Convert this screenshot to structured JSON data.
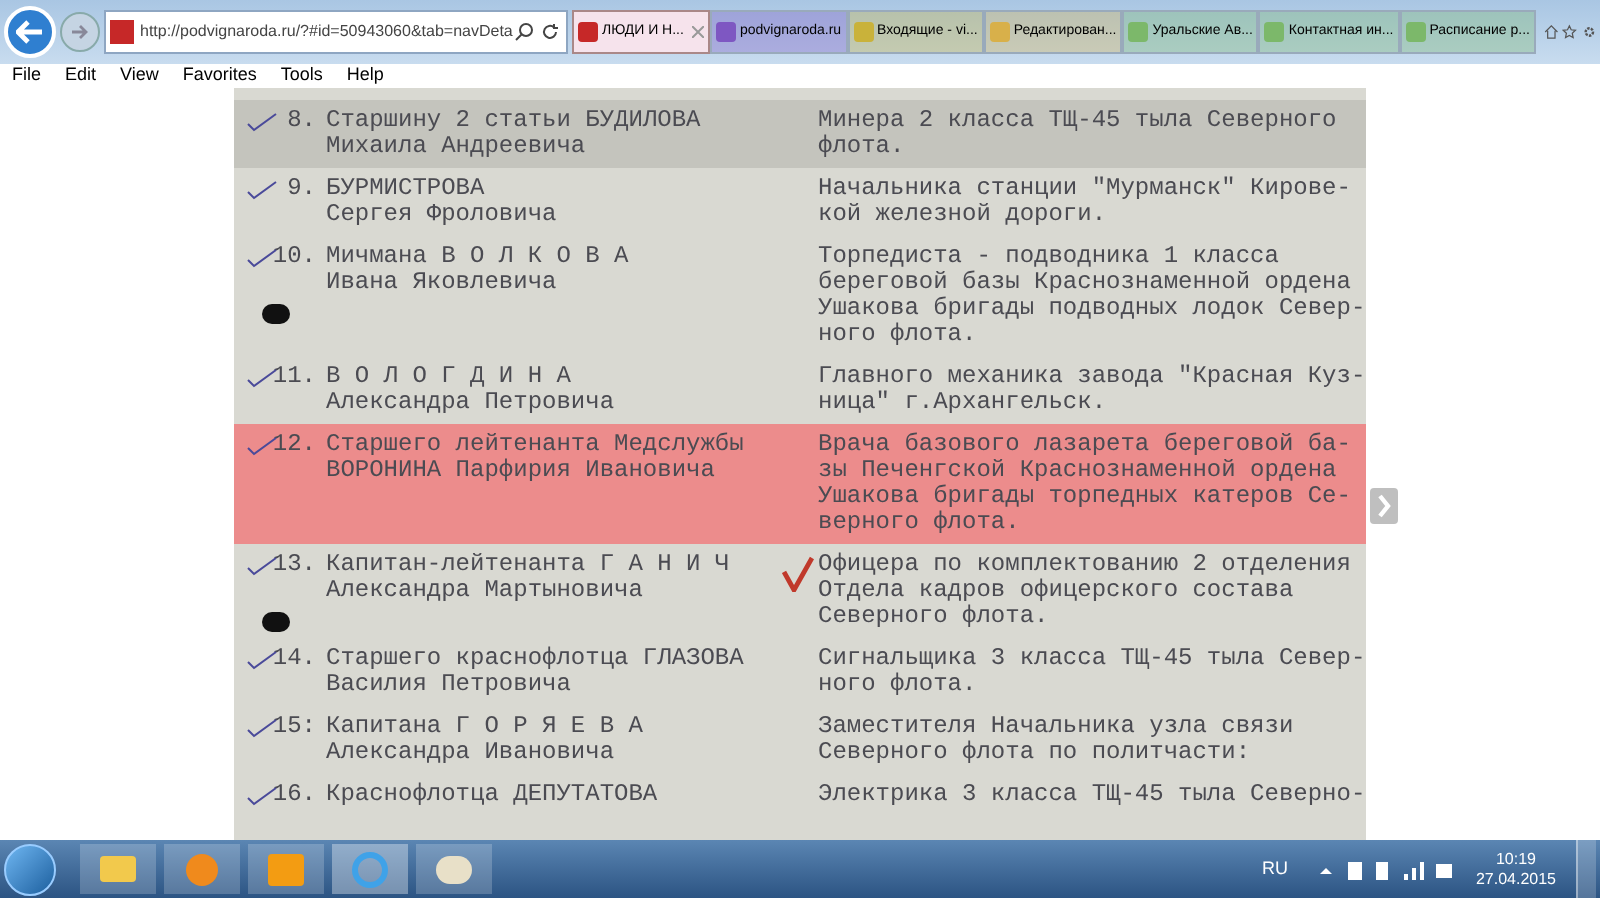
{
  "browser": {
    "address": "http://podvignaroda.ru/?#id=50943060&tab=navDeta",
    "tabs": [
      {
        "label": "ЛЮДИ И Н...",
        "selected": true,
        "color": "#c62828"
      },
      {
        "label": "podvignaroda.ru",
        "selected": false,
        "color": "#7e57c2"
      },
      {
        "label": "Входящие - vi...",
        "selected": false,
        "color": "#c9b23a"
      },
      {
        "label": "Редактирован...",
        "selected": false,
        "color": "#d8b04a"
      },
      {
        "label": "Уральские Ав...",
        "selected": false,
        "color": "#7cb86a"
      },
      {
        "label": "Контактная ин...",
        "selected": false,
        "color": "#7cb86a"
      },
      {
        "label": "Расписание р...",
        "selected": false,
        "color": "#7cb86a"
      }
    ],
    "menu": [
      "File",
      "Edit",
      "View",
      "Favorites",
      "Tools",
      "Help"
    ]
  },
  "document": {
    "rows": [
      {
        "number": "8.",
        "name": [
          "Старшину 2 статьи БУДИЛОВА",
          "Михаила Андреевича"
        ],
        "description": [
          "Минера 2 класса ТЩ-45 тыла Северного",
          "флота."
        ],
        "ticked": true,
        "highlighted": false,
        "shaded": true,
        "ink_blot": false,
        "red_check": false
      },
      {
        "number": "9.",
        "name": [
          "БУРМИСТРОВА",
          "Сергея Фроловича"
        ],
        "description": [
          "Начальника станции \"Мурманск\" Кирове-",
          "кой железной дороги."
        ],
        "ticked": true,
        "highlighted": false,
        "shaded": false,
        "ink_blot": false,
        "red_check": false
      },
      {
        "number": "10.",
        "name": [
          "Мичмана В О Л К О В А",
          "Ивана Яковлевича"
        ],
        "description": [
          "Торпедиста - подводника 1 класса",
          "береговой базы Краснознаменной ордена",
          "Ушакова бригады подводных лодок Север-",
          "ного флота."
        ],
        "ticked": true,
        "highlighted": false,
        "shaded": false,
        "ink_blot": true,
        "red_check": false
      },
      {
        "number": "11.",
        "name": [
          "В О Л О Г Д И Н А",
          "Александра Петровича"
        ],
        "description": [
          "Главного механика завода \"Красная Куз-",
          "ница\" г.Архангельск."
        ],
        "ticked": true,
        "highlighted": false,
        "shaded": false,
        "ink_blot": false,
        "red_check": false
      },
      {
        "number": "12.",
        "name": [
          "Старшего лейтенанта Медслужбы",
          "ВОРОНИНА Парфирия Ивановича"
        ],
        "description": [
          "Врача базового лазарета береговой ба-",
          "зы Печенгской Краснознаменной ордена",
          "Ушакова бригады торпедных катеров Се-",
          "верного флота."
        ],
        "ticked": true,
        "highlighted": true,
        "shaded": false,
        "ink_blot": false,
        "red_check": false
      },
      {
        "number": "13.",
        "name": [
          "Капитан-лейтенанта Г А Н И Ч",
          "Александра Мартыновича"
        ],
        "description": [
          "Офицера по комплектованию 2 отделения",
          "Отдела кадров офицерского состава",
          "Северного флота."
        ],
        "ticked": true,
        "highlighted": false,
        "shaded": false,
        "ink_blot": true,
        "red_check": true
      },
      {
        "number": "14.",
        "name": [
          "Старшего краснофлотца ГЛАЗОВА",
          "Василия Петровича"
        ],
        "description": [
          "Сигнальщика 3 класса ТЩ-45 тыла Север-",
          "ного флота."
        ],
        "ticked": true,
        "highlighted": false,
        "shaded": false,
        "ink_blot": false,
        "red_check": false
      },
      {
        "number": "15:",
        "name": [
          "Капитана Г О Р Я Е В А",
          "Александра Ивановича"
        ],
        "description": [
          "Заместителя Начальника узла связи",
          "Северного флота по политчасти:"
        ],
        "ticked": true,
        "highlighted": false,
        "shaded": false,
        "ink_blot": false,
        "red_check": false
      },
      {
        "number": "16.",
        "name": [
          "Краснофлотца ДЕПУТАТОВА"
        ],
        "description": [
          "Электрика 3 класса ТЩ-45 тыла Северно-"
        ],
        "ticked": true,
        "highlighted": false,
        "shaded": false,
        "ink_blot": false,
        "red_check": false
      }
    ]
  },
  "taskbar": {
    "language": "RU",
    "time": "10:19",
    "date": "27.04.2015"
  }
}
